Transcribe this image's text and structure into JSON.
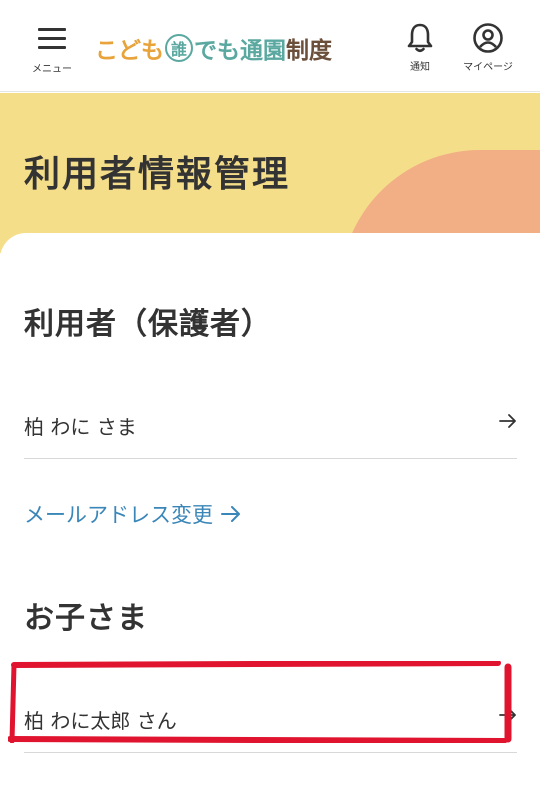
{
  "header": {
    "menu_label": "メニュー",
    "logo": {
      "part1": "こども",
      "circled": "誰",
      "part2": "でも",
      "part3": "通園",
      "part4": "制度"
    },
    "notify_label": "通知",
    "mypage_label": "マイページ"
  },
  "hero": {
    "title": "利用者情報管理"
  },
  "guardian": {
    "title": "利用者（保護者）",
    "name": "柏 わに さま",
    "email_link": "メールアドレス変更"
  },
  "children": {
    "title": "お子さま",
    "items": [
      {
        "name": "柏 わに太郎 さん"
      }
    ]
  },
  "colors": {
    "hero_bg": "#f5de8a",
    "blob": "#f2ae85",
    "link": "#3a86b8",
    "logo_orange": "#e8a33a",
    "logo_teal": "#5aa8a0",
    "logo_brown": "#6b4f3a",
    "highlight": "#e0142f"
  },
  "icons": [
    "hamburger-icon",
    "bell-icon",
    "user-circle-icon",
    "arrow-right-icon"
  ]
}
